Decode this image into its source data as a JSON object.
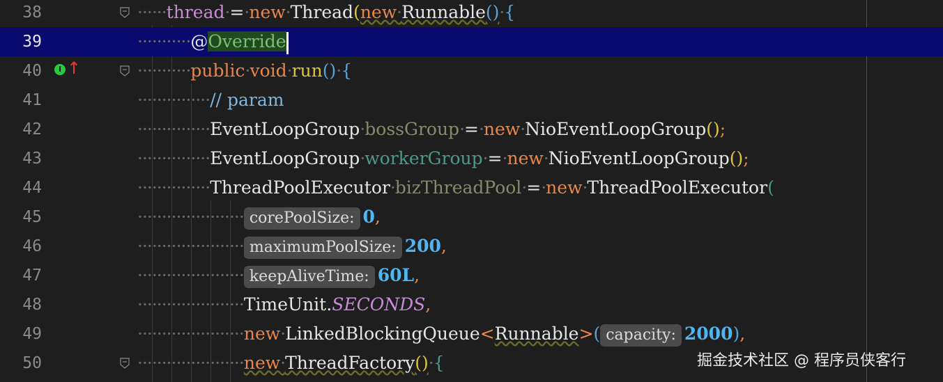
{
  "editor": {
    "lines": [
      {
        "num": "38"
      },
      {
        "num": "39"
      },
      {
        "num": "40"
      },
      {
        "num": "41"
      },
      {
        "num": "42"
      },
      {
        "num": "43"
      },
      {
        "num": "44"
      },
      {
        "num": "45"
      },
      {
        "num": "46"
      },
      {
        "num": "47"
      },
      {
        "num": "48"
      },
      {
        "num": "49"
      },
      {
        "num": "50"
      }
    ],
    "tokens": {
      "thread": "thread",
      "eq": "=",
      "new": "new",
      "Thread": "Thread",
      "lparen": "(",
      "Runnable": "Runnable",
      "parens": "()",
      "lbrace": "{",
      "at": "@",
      "Override": "Override",
      "public": "public",
      "void": "void",
      "run": "run",
      "comment": "// param",
      "EventLoopGroup": "EventLoopGroup",
      "bossGroup": "bossGroup",
      "workerGroup": "workerGroup",
      "NioEventLoopGroup": "NioEventLoopGroup",
      "semi": ";",
      "ThreadPoolExecutor": "ThreadPoolExecutor",
      "bizThreadPool": "bizThreadPool",
      "hint_core": "corePoolSize:",
      "v_core": "0",
      "comma": ",",
      "hint_max": "maximumPoolSize:",
      "v_max": "200",
      "hint_keep": "keepAliveTime:",
      "v_keep": "60L",
      "TimeUnit": "TimeUnit.",
      "SECONDS": "SECONDS",
      "LinkedBlockingQueue": "LinkedBlockingQueue",
      "lt": "<",
      "gt": ">",
      "hint_cap": "capacity:",
      "v_cap": "2000",
      "rparen": ")",
      "ThreadFactory": "ThreadFactory"
    }
  },
  "watermark": "掘金技术社区 @ 程序员侠客行"
}
